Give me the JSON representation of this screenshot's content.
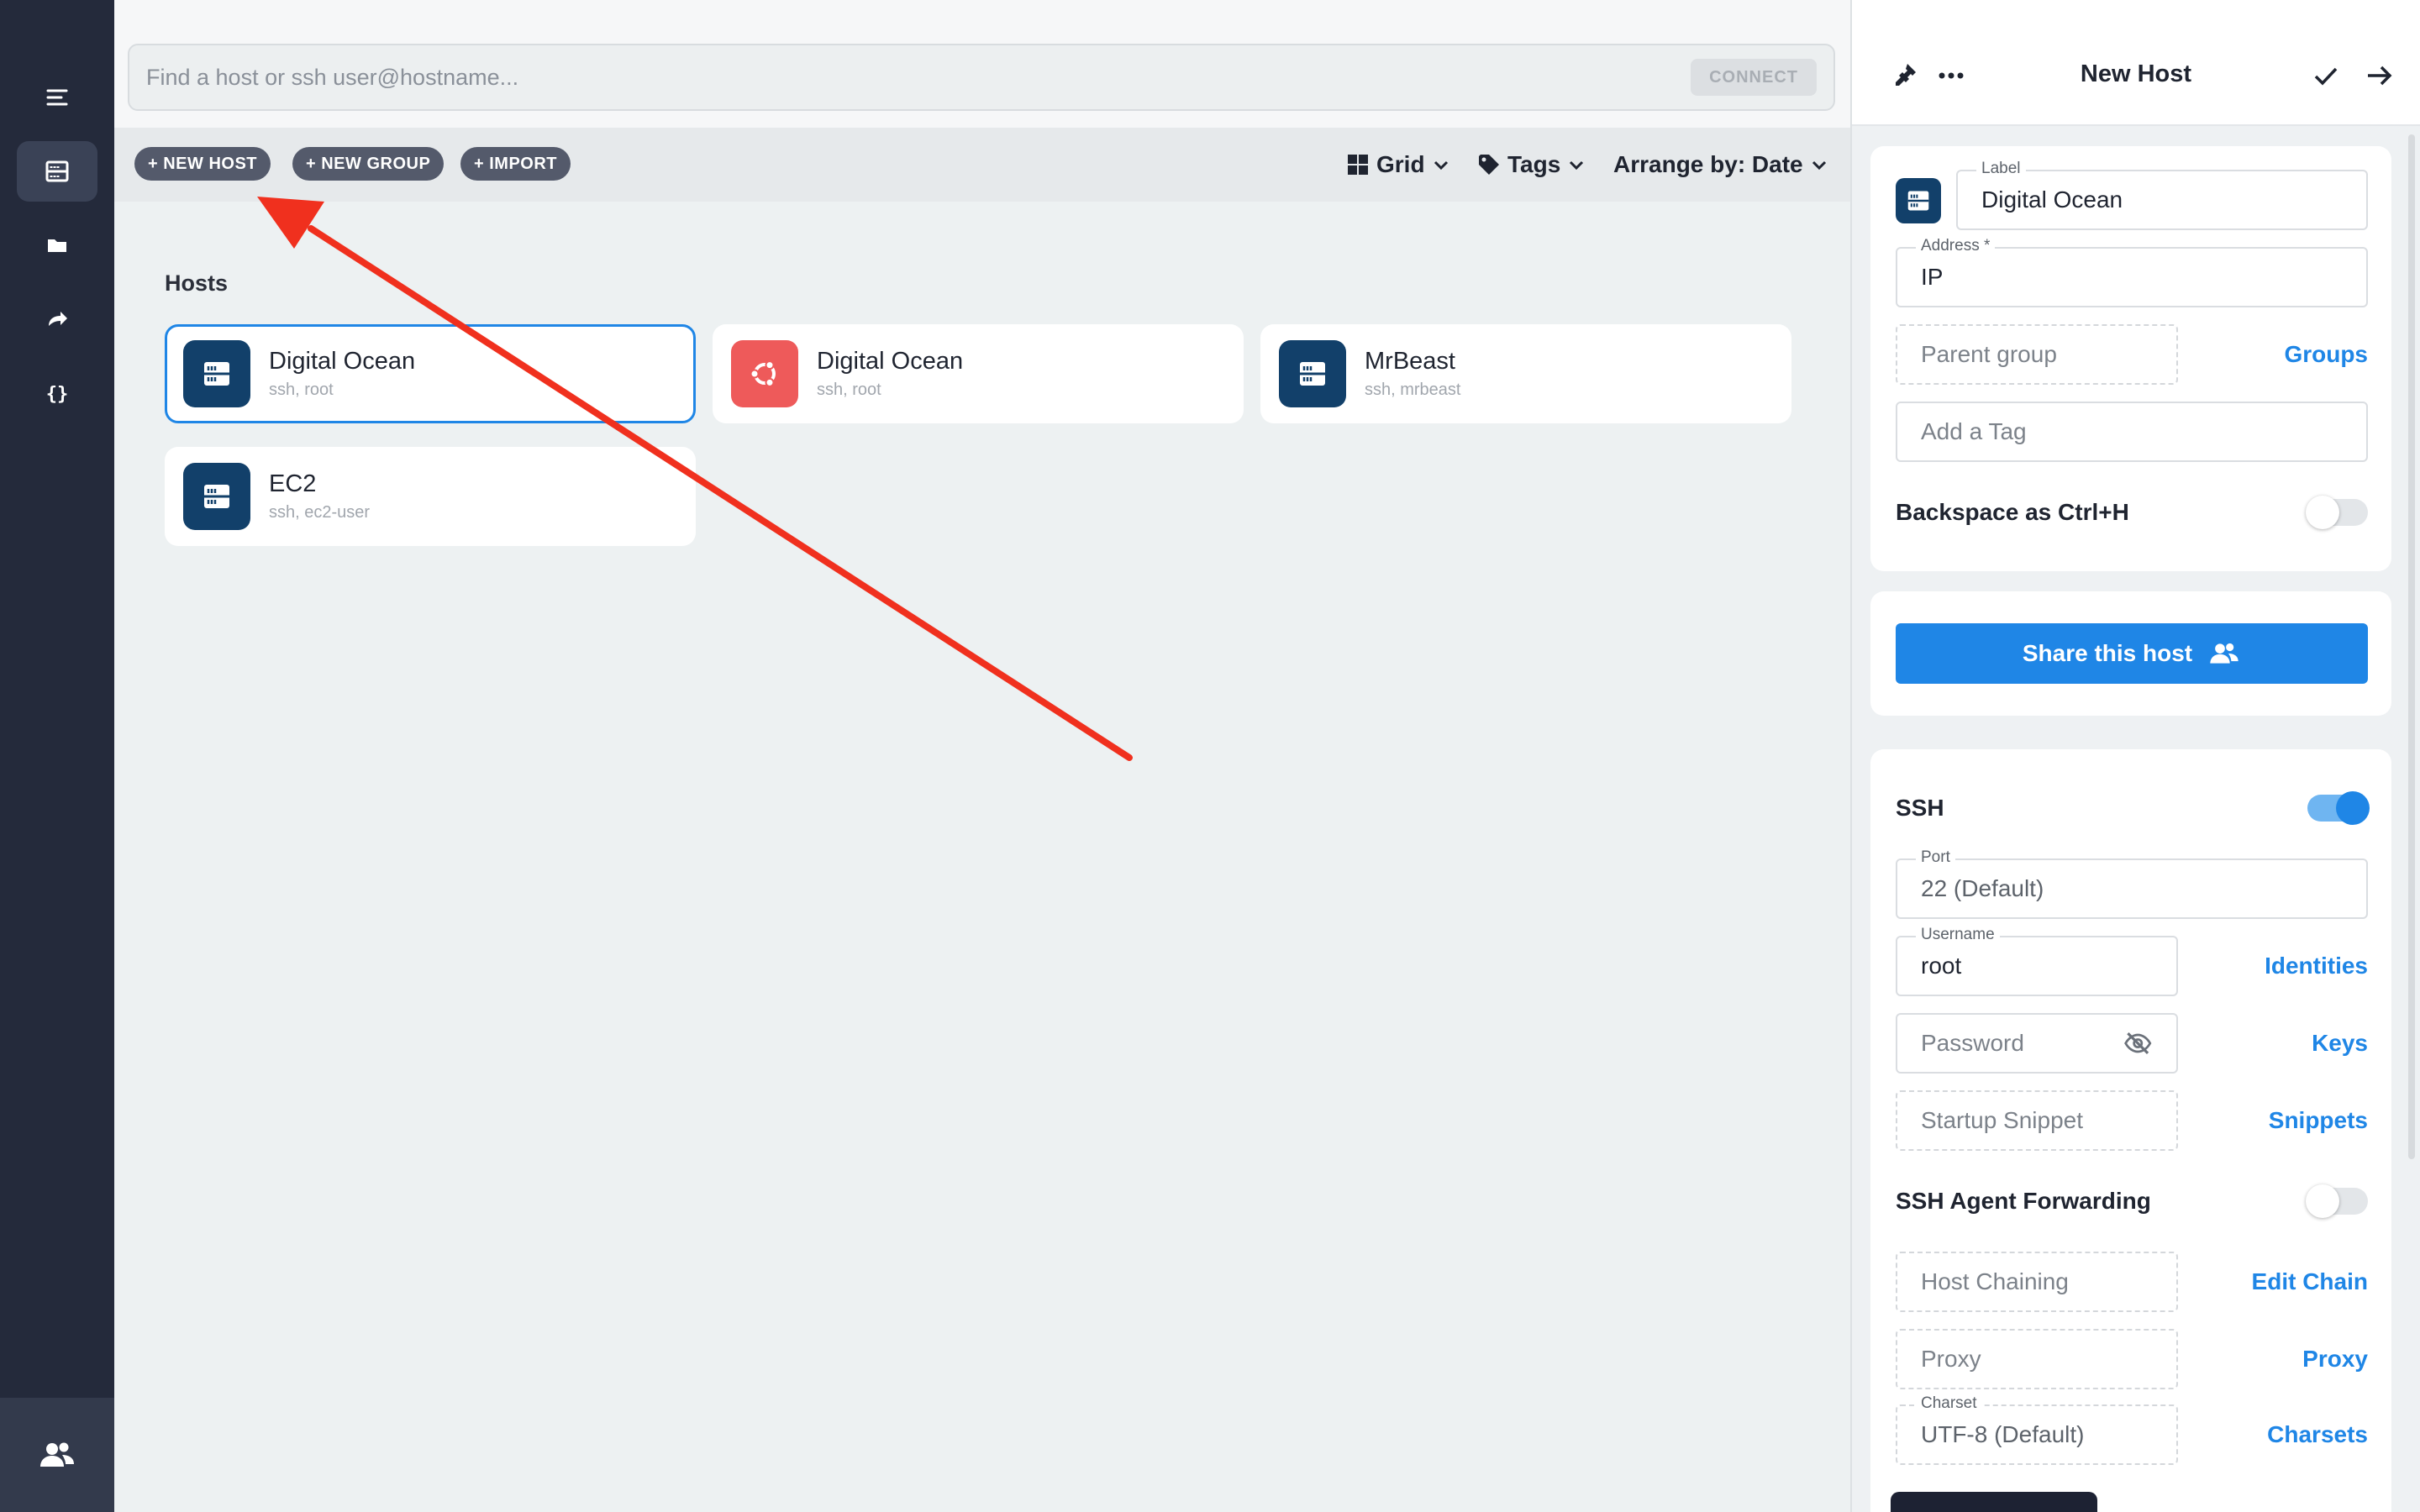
{
  "search": {
    "placeholder": "Find a host or ssh user@hostname...",
    "connect_label": "CONNECT"
  },
  "toolbar": {
    "new_host": "+ NEW HOST",
    "new_group": "+ NEW GROUP",
    "import": "+ IMPORT",
    "view_label": "Grid",
    "tags_label": "Tags",
    "arrange_label": "Arrange by: Date"
  },
  "hosts_section": {
    "title": "Hosts"
  },
  "hosts": [
    {
      "name": "Digital Ocean",
      "sub": "ssh, root",
      "icon": "server-icon"
    },
    {
      "name": "Digital Ocean",
      "sub": "ssh, root",
      "icon": "ubuntu-icon"
    },
    {
      "name": "MrBeast",
      "sub": "ssh, mrbeast",
      "icon": "server-icon"
    },
    {
      "name": "EC2",
      "sub": "ssh, ec2-user",
      "icon": "server-icon"
    }
  ],
  "panel": {
    "title": "New Host",
    "label_caption": "Label",
    "label_value": "Digital Ocean",
    "address_caption": "Address *",
    "address_value": "IP",
    "parent_group_placeholder": "Parent group",
    "groups_link": "Groups",
    "tag_placeholder": "Add a Tag",
    "backspace_label": "Backspace as Ctrl+H",
    "share_label": "Share this host",
    "ssh_label": "SSH",
    "port_caption": "Port",
    "port_value": "22 (Default)",
    "username_caption": "Username",
    "username_value": "root",
    "identities_link": "Identities",
    "password_placeholder": "Password",
    "keys_link": "Keys",
    "snippet_placeholder": "Startup Snippet",
    "snippets_link": "Snippets",
    "agent_forwarding_label": "SSH Agent Forwarding",
    "chaining_placeholder": "Host Chaining",
    "edit_chain_link": "Edit Chain",
    "proxy_placeholder": "Proxy",
    "proxy_link": "Proxy",
    "charset_caption": "Charset",
    "charset_value": "UTF-8 (Default)",
    "charsets_link": "Charsets"
  },
  "toggles": {
    "backspace": false,
    "ssh": true,
    "agent_forwarding": false
  },
  "colors": {
    "accent": "#1f86e6",
    "rail": "#242a3b",
    "annotation_arrow": "#f0301e",
    "host_icon": "#12406a",
    "ubuntu_icon": "#ee5a5a"
  }
}
